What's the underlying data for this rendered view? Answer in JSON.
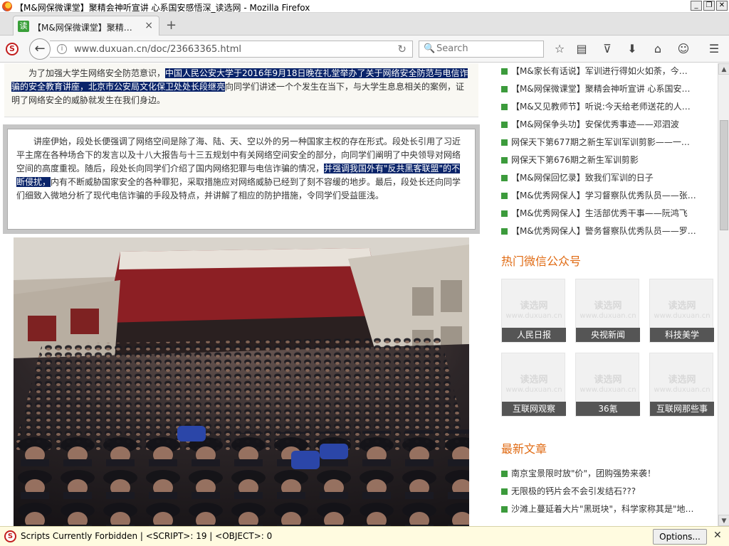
{
  "window": {
    "title": "【M&网保微课堂】聚精会神听宣讲 心系国安感悟深_读选网 - Mozilla Firefox",
    "min_label": "_",
    "max_label": "❐",
    "close_label": "✕"
  },
  "tab": {
    "favicon": "读",
    "label": "【M&网保微课堂】聚精会神…",
    "close": "×",
    "new_tab": "+"
  },
  "nav": {
    "url": "www.duxuan.cn/doc/23663365.html",
    "search_placeholder": "Search",
    "icons": [
      "star-icon",
      "reading-list-icon",
      "pocket-icon",
      "download-icon",
      "home-icon",
      "chat-icon",
      "menu-icon"
    ]
  },
  "article": {
    "p1_pre": "为了加强大学生网络安全防范意识，",
    "p1_hl": "中国人民公安大学于2016年9月18日晚在礼堂举办了关于网络安全防范与电信诈骗的安全教育讲座，北京市公安局文化保卫处处长段继亮",
    "p1_post": "向同学们讲述一个个发生在当下，与大学生息息相关的案例，证明了网络安全的威胁就发生在我们身边。",
    "p2_pre": "讲座伊始，段处长便强调了网络空间是除了海、陆、天、空以外的另一种国家主权的存在形式。段处长引用了习近平主席在各种场合下的发言以及十八大报告与十三五规划中有关网络空间安全的部分，向同学们阐明了中央领导对网络空间的高度重视。随后，段处长向同学们介绍了国内网络犯罪与电信诈骗的情况，",
    "p2_hl": "并强调我国外有\"反共黑客联盟\"的不断侵扰，",
    "p2_post": "内有不断威胁国家安全的各种罪犯，采取措施应对网络威胁已经到了刻不容缓的地步。最后，段处长还向同学们细致入微地分析了现代电信诈骗的手段及特点，并讲解了相应的防护措施，令同学们受益匪浅。"
  },
  "sidebar": {
    "news": [
      "【M&家长有话说】军训进行得如火如荼，今…",
      "【M&网保微课堂】聚精会神听宣讲 心系国安…",
      "【M&又见教师节】听说:今天给老师送花的人…",
      "【M&网保争头功】安保优秀事迹——邓泗波",
      "网保天下第677期之新生军训军训剪影——一…",
      "网保天下第676期之新生军训剪影",
      "【M&网保回忆录】致我们军训的日子",
      "【M&优秀网保人】学习督察队优秀队员——张…",
      "【M&优秀网保人】生活部优秀干事——阮鸿飞",
      "【M&优秀网保人】警务督察队优秀队员——罗…"
    ],
    "wechat_title": "热门微信公众号",
    "watermark1": "读选网",
    "watermark2": "www.duxuan.cn",
    "wechat": [
      "人民日报",
      "央视新闻",
      "科技美学",
      "互联网观察",
      "36氪",
      "互联网那些事"
    ],
    "latest_title": "最新文章",
    "latest": [
      "南京宝景限时放\"价\"，团购强势来袭！",
      "无限极的钙片会不会引发结石???",
      "沙滩上蔓延着大片\"黑斑块\"，科学家称其是\"地…"
    ]
  },
  "status": {
    "message": "Scripts Currently Forbidden | <SCRIPT>: 19 | <OBJECT>: 0",
    "options": "Options...",
    "close": "✕"
  }
}
